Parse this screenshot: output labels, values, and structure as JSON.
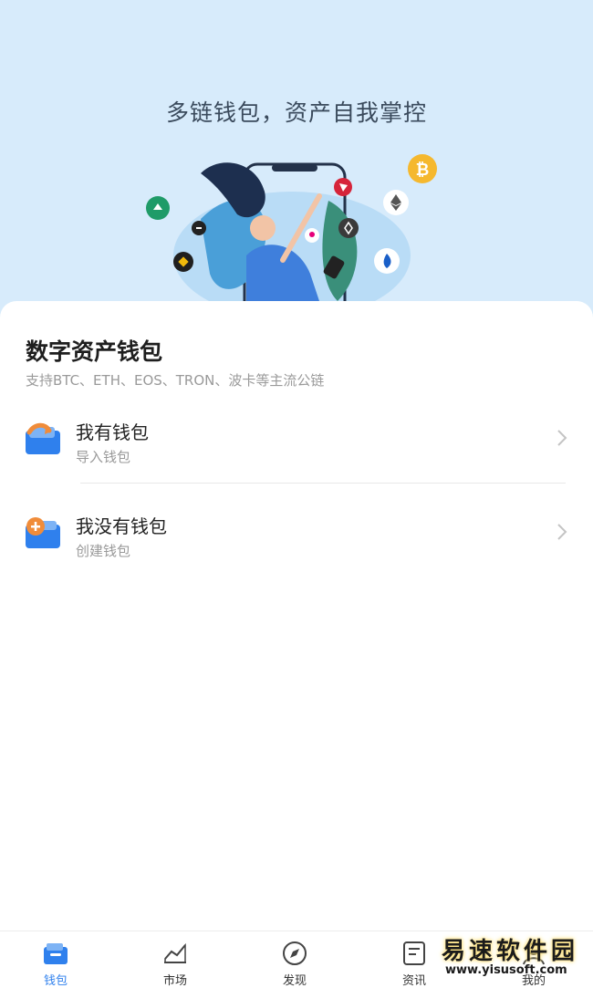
{
  "hero": {
    "title": "多链钱包，资产自我掌控"
  },
  "sheet": {
    "title": "数字资产钱包",
    "subtitle": "支持BTC、ETH、EOS、TRON、波卡等主流公链"
  },
  "options": [
    {
      "label": "我有钱包",
      "desc": "导入钱包",
      "icon": "wallet-import-icon"
    },
    {
      "label": "我没有钱包",
      "desc": "创建钱包",
      "icon": "wallet-create-icon"
    }
  ],
  "tabbar": {
    "tabs": [
      {
        "label": "钱包",
        "icon": "wallet-icon",
        "active": true
      },
      {
        "label": "市场",
        "icon": "chart-icon",
        "active": false
      },
      {
        "label": "发现",
        "icon": "compass-icon",
        "active": false
      },
      {
        "label": "资讯",
        "icon": "news-icon",
        "active": false
      },
      {
        "label": "我的",
        "icon": "profile-icon",
        "active": false
      }
    ]
  },
  "watermark": {
    "title": "易速软件园",
    "url": "www.yisusoft.com"
  },
  "colors": {
    "accent": "#2f80ed",
    "hero_bg": "#d7ebfb",
    "orange": "#f08c3a"
  }
}
